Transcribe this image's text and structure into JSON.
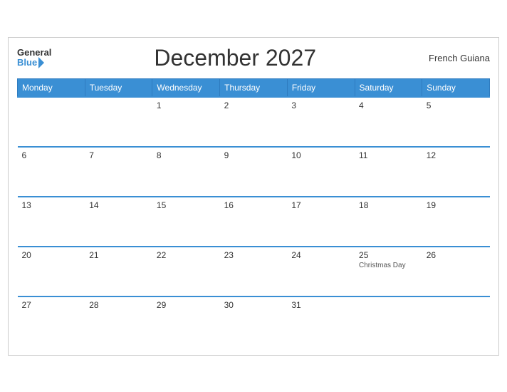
{
  "header": {
    "logo_general": "General",
    "logo_blue": "Blue",
    "title": "December 2027",
    "region": "French Guiana"
  },
  "days_of_week": [
    "Monday",
    "Tuesday",
    "Wednesday",
    "Thursday",
    "Friday",
    "Saturday",
    "Sunday"
  ],
  "weeks": [
    [
      {
        "date": "",
        "holiday": ""
      },
      {
        "date": "",
        "holiday": ""
      },
      {
        "date": "1",
        "holiday": ""
      },
      {
        "date": "2",
        "holiday": ""
      },
      {
        "date": "3",
        "holiday": ""
      },
      {
        "date": "4",
        "holiday": ""
      },
      {
        "date": "5",
        "holiday": ""
      }
    ],
    [
      {
        "date": "6",
        "holiday": ""
      },
      {
        "date": "7",
        "holiday": ""
      },
      {
        "date": "8",
        "holiday": ""
      },
      {
        "date": "9",
        "holiday": ""
      },
      {
        "date": "10",
        "holiday": ""
      },
      {
        "date": "11",
        "holiday": ""
      },
      {
        "date": "12",
        "holiday": ""
      }
    ],
    [
      {
        "date": "13",
        "holiday": ""
      },
      {
        "date": "14",
        "holiday": ""
      },
      {
        "date": "15",
        "holiday": ""
      },
      {
        "date": "16",
        "holiday": ""
      },
      {
        "date": "17",
        "holiday": ""
      },
      {
        "date": "18",
        "holiday": ""
      },
      {
        "date": "19",
        "holiday": ""
      }
    ],
    [
      {
        "date": "20",
        "holiday": ""
      },
      {
        "date": "21",
        "holiday": ""
      },
      {
        "date": "22",
        "holiday": ""
      },
      {
        "date": "23",
        "holiday": ""
      },
      {
        "date": "24",
        "holiday": ""
      },
      {
        "date": "25",
        "holiday": "Christmas Day"
      },
      {
        "date": "26",
        "holiday": ""
      }
    ],
    [
      {
        "date": "27",
        "holiday": ""
      },
      {
        "date": "28",
        "holiday": ""
      },
      {
        "date": "29",
        "holiday": ""
      },
      {
        "date": "30",
        "holiday": ""
      },
      {
        "date": "31",
        "holiday": ""
      },
      {
        "date": "",
        "holiday": ""
      },
      {
        "date": "",
        "holiday": ""
      }
    ]
  ],
  "colors": {
    "header_bg": "#3a8fd4",
    "accent": "#3a8fd4"
  }
}
